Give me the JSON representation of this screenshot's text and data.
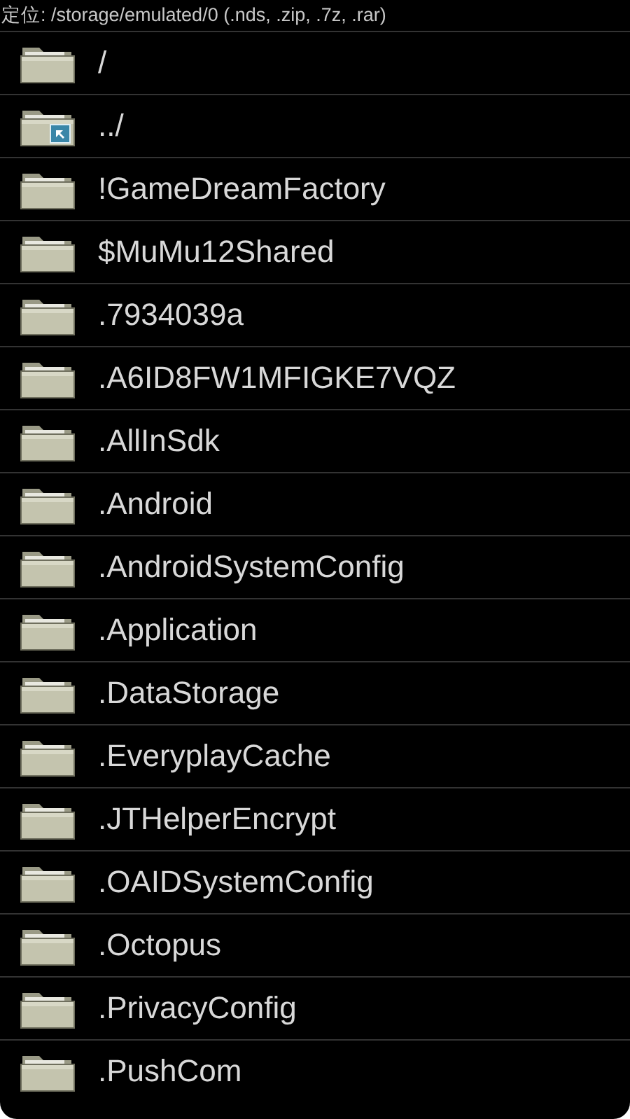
{
  "location": "定位: /storage/emulated/0 (.nds, .zip, .7z, .rar)",
  "items": [
    {
      "kind": "folder",
      "name": "/"
    },
    {
      "kind": "parent",
      "name": "../"
    },
    {
      "kind": "folder",
      "name": "!GameDreamFactory"
    },
    {
      "kind": "folder",
      "name": "$MuMu12Shared"
    },
    {
      "kind": "folder",
      "name": ".7934039a"
    },
    {
      "kind": "folder",
      "name": ".A6ID8FW1MFIGKE7VQZ"
    },
    {
      "kind": "folder",
      "name": ".AllInSdk"
    },
    {
      "kind": "folder",
      "name": ".Android"
    },
    {
      "kind": "folder",
      "name": ".AndroidSystemConfig"
    },
    {
      "kind": "folder",
      "name": ".Application"
    },
    {
      "kind": "folder",
      "name": ".DataStorage"
    },
    {
      "kind": "folder",
      "name": ".EveryplayCache"
    },
    {
      "kind": "folder",
      "name": ".JTHelperEncrypt"
    },
    {
      "kind": "folder",
      "name": ".OAIDSystemConfig"
    },
    {
      "kind": "folder",
      "name": ".Octopus"
    },
    {
      "kind": "folder",
      "name": ".PrivacyConfig"
    },
    {
      "kind": "folder",
      "name": ".PushCom"
    }
  ]
}
